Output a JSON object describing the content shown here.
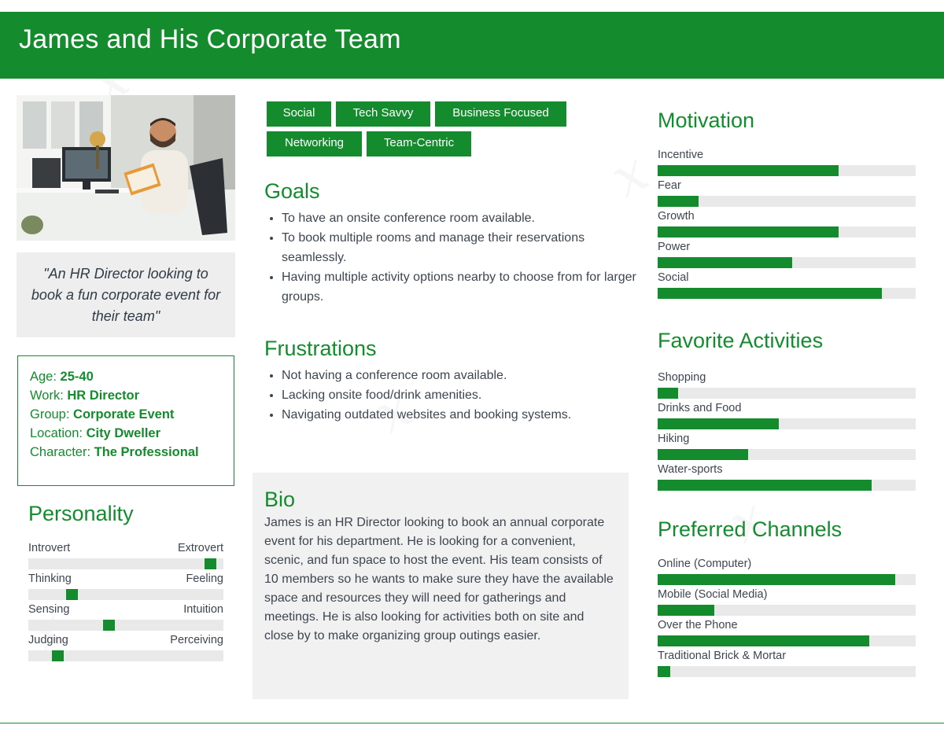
{
  "header": {
    "title": "James and His Corporate Team"
  },
  "profile": {
    "quote": "\"An HR Director looking to book a fun corporate event for their team\"",
    "info": [
      {
        "key": "Age:",
        "value": "25-40"
      },
      {
        "key": "Work:",
        "value": "HR Director"
      },
      {
        "key": "Group:",
        "value": "Corporate Event"
      },
      {
        "key": "Location:",
        "value": "City Dweller"
      },
      {
        "key": "Character:",
        "value": "The Professional"
      }
    ]
  },
  "personality": {
    "title": "Personality",
    "scales": [
      {
        "left": "Introvert",
        "right": "Extrovert",
        "position": 0.93
      },
      {
        "left": "Thinking",
        "right": "Feeling",
        "position": 0.22
      },
      {
        "left": "Sensing",
        "right": "Intuition",
        "position": 0.41
      },
      {
        "left": "Judging",
        "right": "Perceiving",
        "position": 0.15
      }
    ]
  },
  "tags": [
    "Social",
    "Tech Savvy",
    "Business Focused",
    "Networking",
    "Team-Centric"
  ],
  "goals": {
    "title": "Goals",
    "items": [
      "To have an onsite conference room available.",
      "To book multiple rooms and manage their reservations seamlessly.",
      "Having multiple activity options nearby to choose from for larger groups."
    ]
  },
  "frustrations": {
    "title": "Frustrations",
    "items": [
      "Not having a conference room available.",
      "Lacking onsite food/drink amenities.",
      "Navigating outdated websites and booking systems."
    ]
  },
  "bio": {
    "title": "Bio",
    "text": "James is an HR Director looking to book an annual corporate event for his department. He is looking for a convenient, scenic, and fun space to host the event. His team consists of 10 members so he wants to make sure they have the available space and resources they will need for gatherings and meetings. He is also looking for activities both on site and close by to make organizing group outings easier."
  },
  "motivation": {
    "title": "Motivation",
    "items": [
      {
        "label": "Incentive",
        "value": 0.7
      },
      {
        "label": "Fear",
        "value": 0.16
      },
      {
        "label": "Growth",
        "value": 0.7
      },
      {
        "label": "Power",
        "value": 0.52
      },
      {
        "label": "Social",
        "value": 0.87
      }
    ]
  },
  "activities": {
    "title": "Favorite Activities",
    "items": [
      {
        "label": "Shopping",
        "value": 0.08
      },
      {
        "label": "Drinks and Food",
        "value": 0.47
      },
      {
        "label": "Hiking",
        "value": 0.35
      },
      {
        "label": "Water-sports",
        "value": 0.83
      }
    ]
  },
  "channels": {
    "title": "Preferred Channels",
    "items": [
      {
        "label": "Online (Computer)",
        "value": 0.92
      },
      {
        "label": "Mobile (Social Media)",
        "value": 0.22
      },
      {
        "label": "Over the Phone",
        "value": 0.82
      },
      {
        "label": "Traditional Brick & Mortar",
        "value": 0.05
      }
    ]
  },
  "colors": {
    "accent": "#148c2e",
    "track": "#e9e9e9",
    "panel": "#f1f1f1"
  }
}
